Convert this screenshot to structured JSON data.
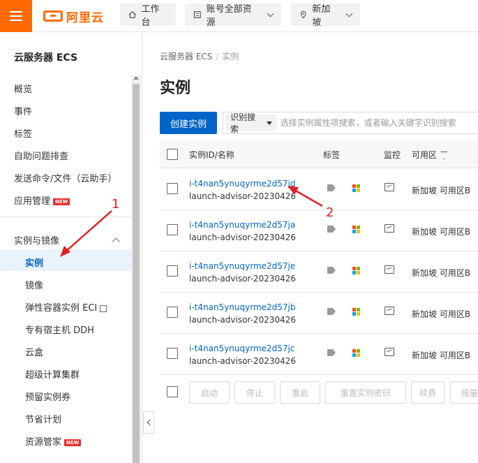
{
  "topbar": {
    "logo_text": "阿里云",
    "workbench_label": "工作台",
    "account_label": "账号全部资源",
    "region_label": "新加坡"
  },
  "sidebar": {
    "title": "云服务器 ECS",
    "items": [
      {
        "label": "概览"
      },
      {
        "label": "事件"
      },
      {
        "label": "标签"
      },
      {
        "label": "自助问题排查"
      },
      {
        "label": "发送命令/文件（云助手）"
      },
      {
        "label": "应用管理",
        "badge": "NEW"
      }
    ],
    "group": {
      "label": "实例与镜像",
      "items": [
        {
          "label": "实例",
          "active": true
        },
        {
          "label": "镜像"
        },
        {
          "label": "弹性容器实例 ECI"
        },
        {
          "label": "专有宿主机 DDH"
        },
        {
          "label": "云盒"
        },
        {
          "label": "超级计算集群"
        },
        {
          "label": "预留实例券"
        },
        {
          "label": "节省计划"
        },
        {
          "label": "资源管家",
          "badge": "NEW"
        }
      ]
    }
  },
  "main": {
    "breadcrumb": [
      "云服务器 ECS",
      "实例"
    ],
    "title": "实例",
    "create_button": "创建实例",
    "search_select": "识别搜索",
    "search_placeholder": "选择实例属性项搜索，或者输入关键字识别搜索",
    "columns": [
      "实例ID/名称",
      "标签",
      "监控",
      "可用区"
    ],
    "rows": [
      {
        "id": "i-t4nan5ynuqyrme2d57jd",
        "name": "launch-advisor-20230426",
        "zone": "新加坡 可用区B"
      },
      {
        "id": "i-t4nan5ynuqyrme2d57ja",
        "name": "launch-advisor-20230426",
        "zone": "新加坡 可用区B"
      },
      {
        "id": "i-t4nan5ynuqyrme2d57je",
        "name": "launch-advisor-20230426",
        "zone": "新加坡 可用区B"
      },
      {
        "id": "i-t4nan5ynuqyrme2d57jb",
        "name": "launch-advisor-20230426",
        "zone": "新加坡 可用区B"
      },
      {
        "id": "i-t4nan5ynuqyrme2d57jc",
        "name": "launch-advisor-20230426",
        "zone": "新加坡 可用区B"
      }
    ],
    "footer_buttons": [
      "启动",
      "停止",
      "重启",
      "重置实例密码",
      "续费",
      "按量"
    ]
  },
  "annotations": [
    "1",
    "2"
  ],
  "colors": {
    "brand": "#ff6a00",
    "primary": "#0064c8",
    "annotation": "#e02020"
  }
}
